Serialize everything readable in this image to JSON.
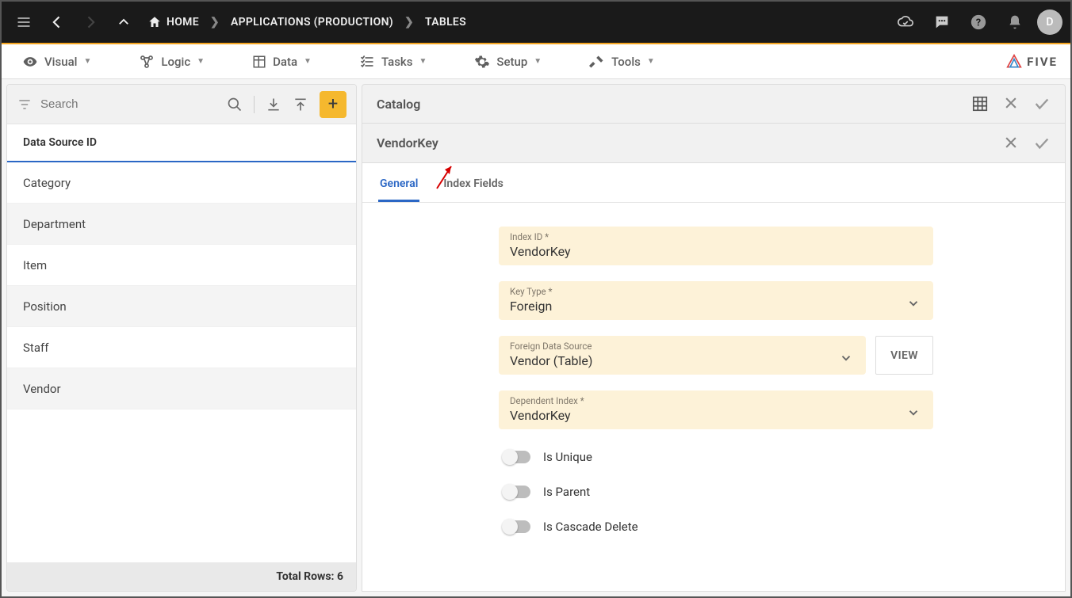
{
  "topbar": {
    "breadcrumbs": [
      "HOME",
      "APPLICATIONS (PRODUCTION)",
      "TABLES"
    ],
    "avatar_letter": "D"
  },
  "menubar": {
    "items": [
      "Visual",
      "Logic",
      "Data",
      "Tasks",
      "Setup",
      "Tools"
    ],
    "brand": "FIVE"
  },
  "leftPanel": {
    "search_placeholder": "Search",
    "column_header": "Data Source ID",
    "rows": [
      "Category",
      "Department",
      "Item",
      "Position",
      "Staff",
      "Vendor"
    ],
    "footer_label": "Total Rows:",
    "footer_count": "6"
  },
  "detail": {
    "section1_title": "Catalog",
    "section2_title": "VendorKey",
    "tabs": [
      "General",
      "Index Fields"
    ],
    "active_tab": "General",
    "fields": {
      "index_id_label": "Index ID *",
      "index_id_value": "VendorKey",
      "key_type_label": "Key Type *",
      "key_type_value": "Foreign",
      "fds_label": "Foreign Data Source",
      "fds_value": "Vendor (Table)",
      "dep_label": "Dependent Index *",
      "dep_value": "VendorKey",
      "view_btn": "VIEW"
    },
    "toggles": {
      "unique": "Is Unique",
      "parent": "Is Parent",
      "cascade": "Is Cascade Delete"
    }
  }
}
